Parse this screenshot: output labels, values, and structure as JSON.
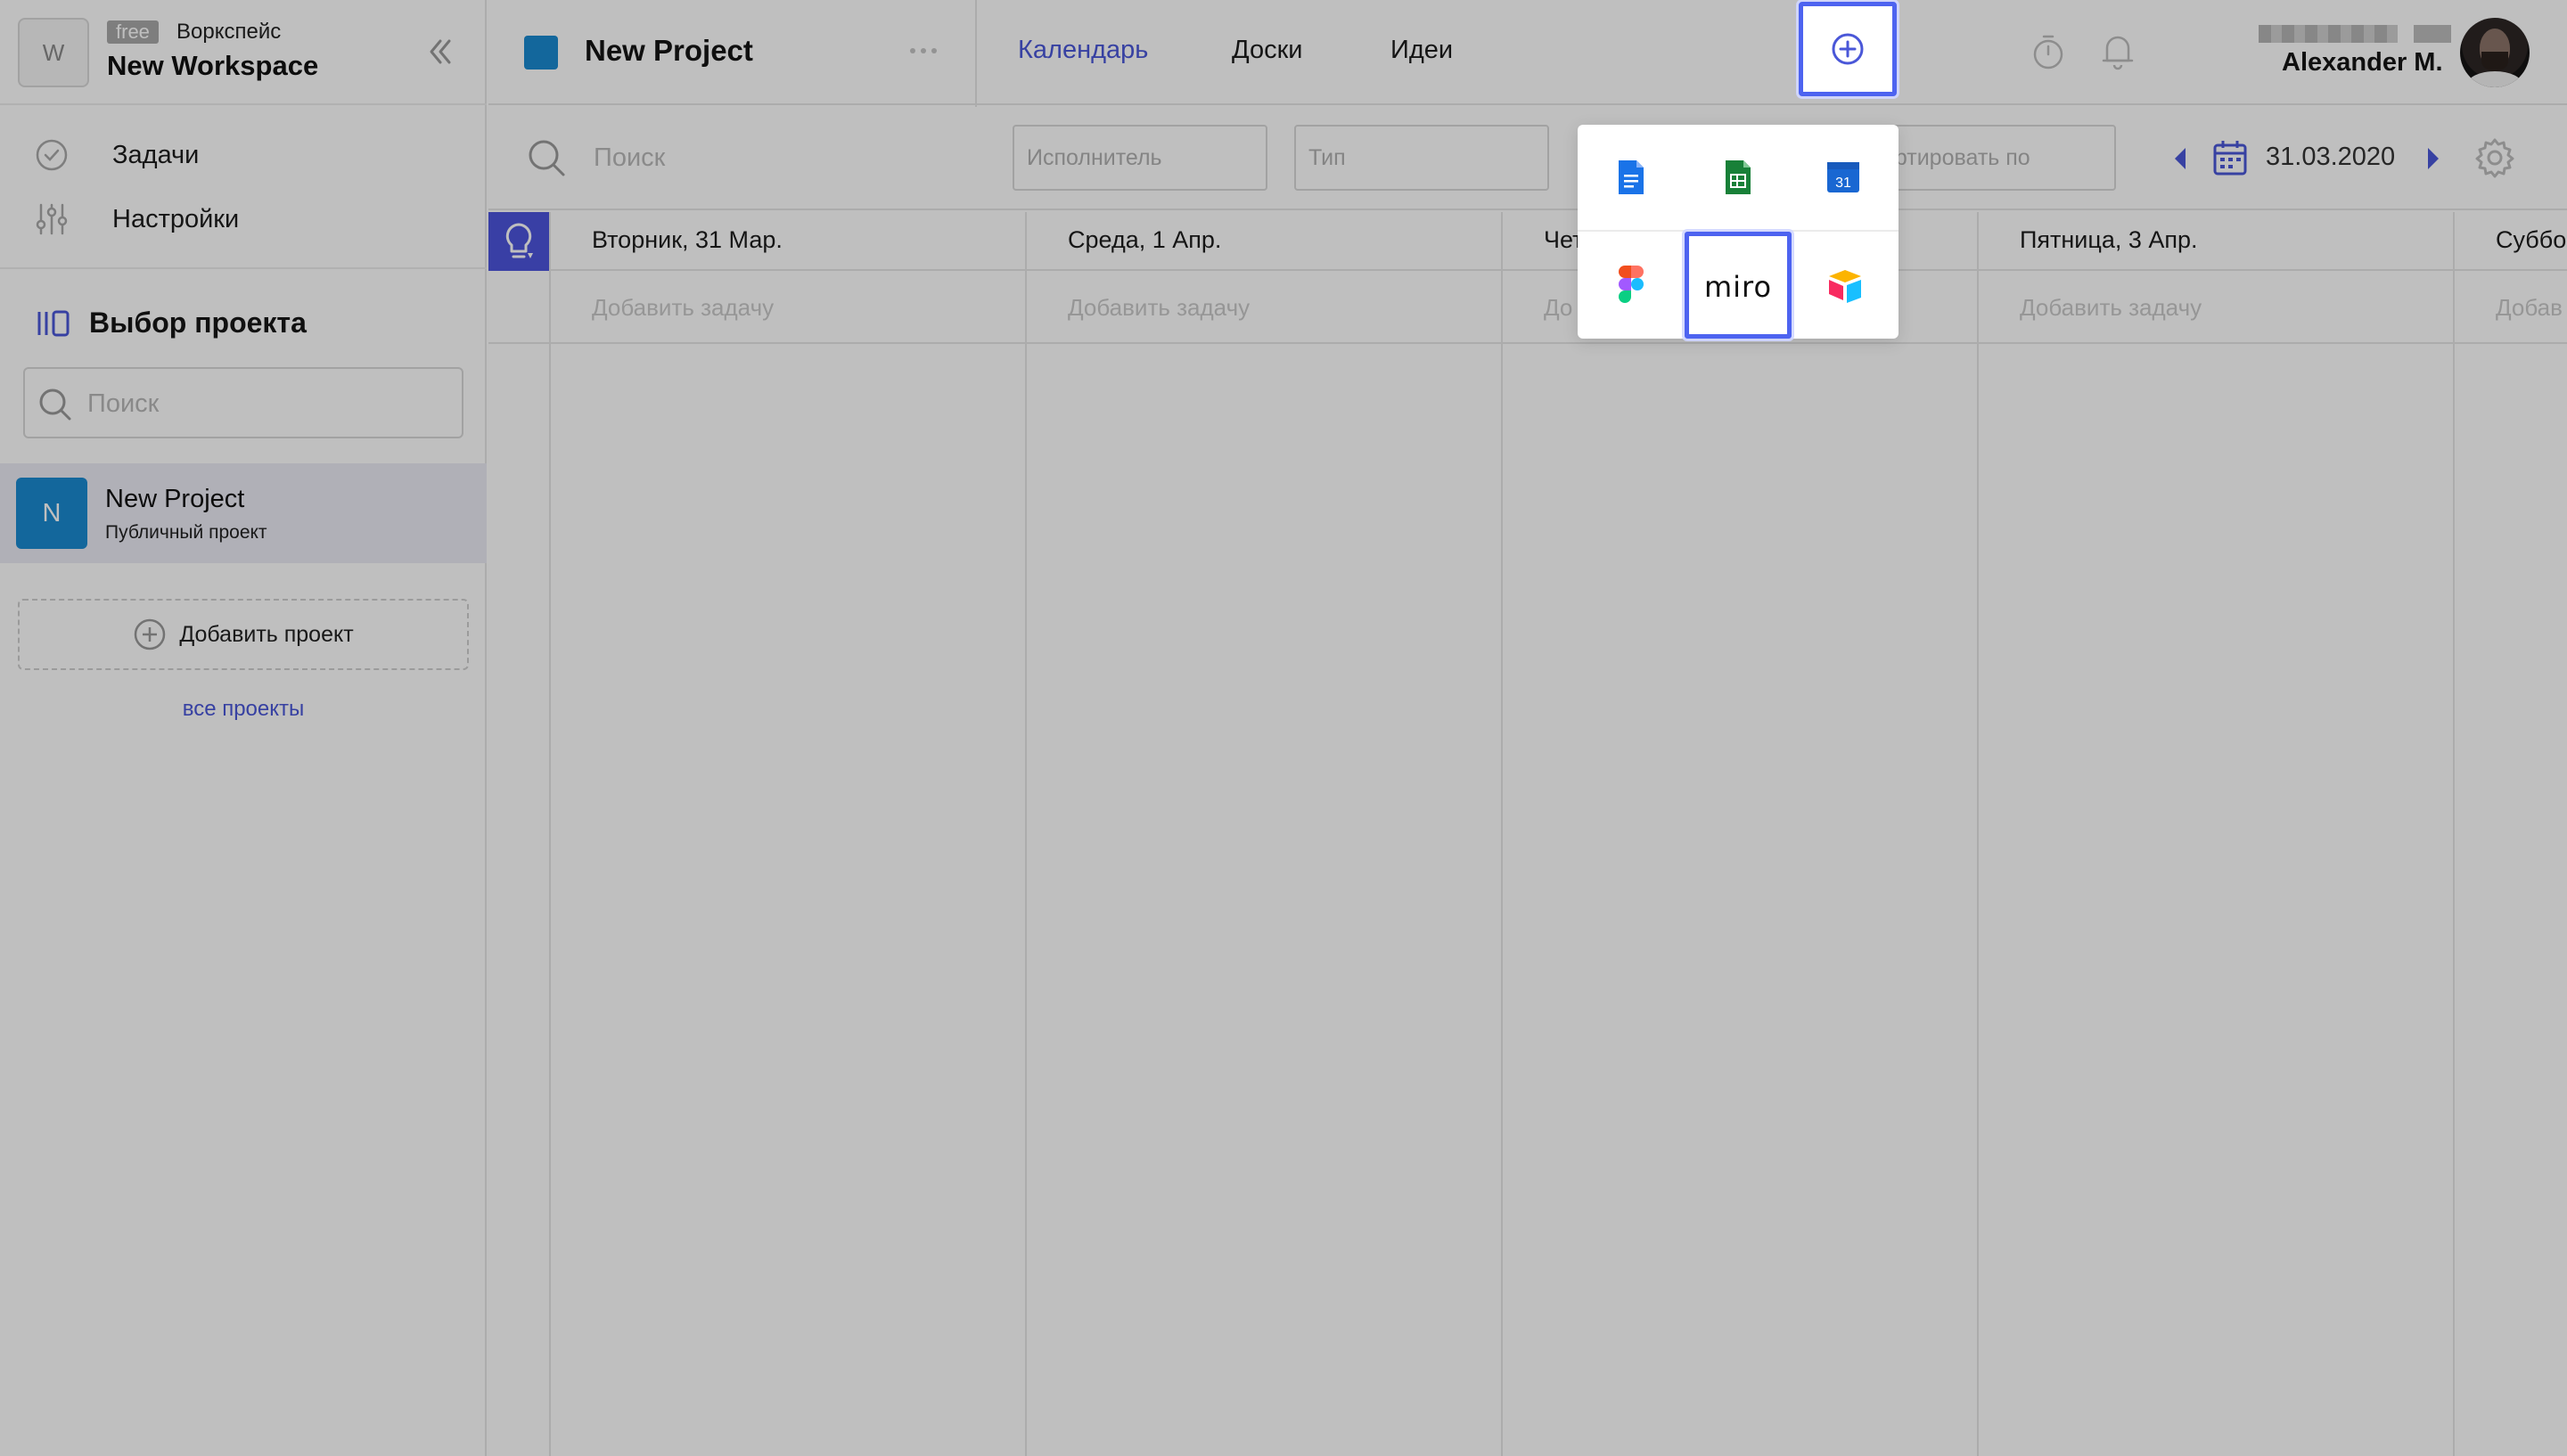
{
  "workspace": {
    "logo_letter": "W",
    "plan_badge": "free",
    "label": "Воркспейс",
    "name": "New Workspace"
  },
  "nav": {
    "tasks": "Задачи",
    "settings": "Настройки"
  },
  "project_select": {
    "title": "Выбор проекта",
    "search_placeholder": "Поиск",
    "projects": [
      {
        "letter": "N",
        "name": "New Project",
        "subtitle": "Публичный проект",
        "color": "#1a8ad0"
      }
    ],
    "add_project": "Добавить проект",
    "all_projects": "все проекты"
  },
  "header": {
    "project_title": "New Project",
    "tabs": [
      {
        "label": "Календарь",
        "active": true
      },
      {
        "label": "Доски",
        "active": false
      },
      {
        "label": "Идеи",
        "active": false
      }
    ],
    "user_name": "Alexander M."
  },
  "toolbar": {
    "search_placeholder": "Поиск",
    "assignee_placeholder": "Исполнитель",
    "type_placeholder": "Тип",
    "sort_placeholder": "ортировать по",
    "date": "31.03.2020"
  },
  "calendar": {
    "days": [
      "Вторник, 31 Мар.",
      "Среда, 1 Апр.",
      "Чет",
      "Пятница, 3 Апр.",
      "Суббо"
    ],
    "add_task": [
      "Добавить задачу",
      "Добавить задачу",
      "До",
      "Добавить задачу",
      "Добав"
    ]
  },
  "integrations_popup": {
    "apps": [
      "google-docs",
      "google-sheets",
      "google-calendar",
      "figma",
      "miro",
      "airtable"
    ],
    "calendar_icon_text": "31",
    "miro_label": "miro",
    "selected": "miro"
  },
  "colors": {
    "accent": "#4a57d8",
    "highlight_border": "#4d63f0",
    "project": "#1a8ad0",
    "idea_cell": "#4d55dd"
  }
}
